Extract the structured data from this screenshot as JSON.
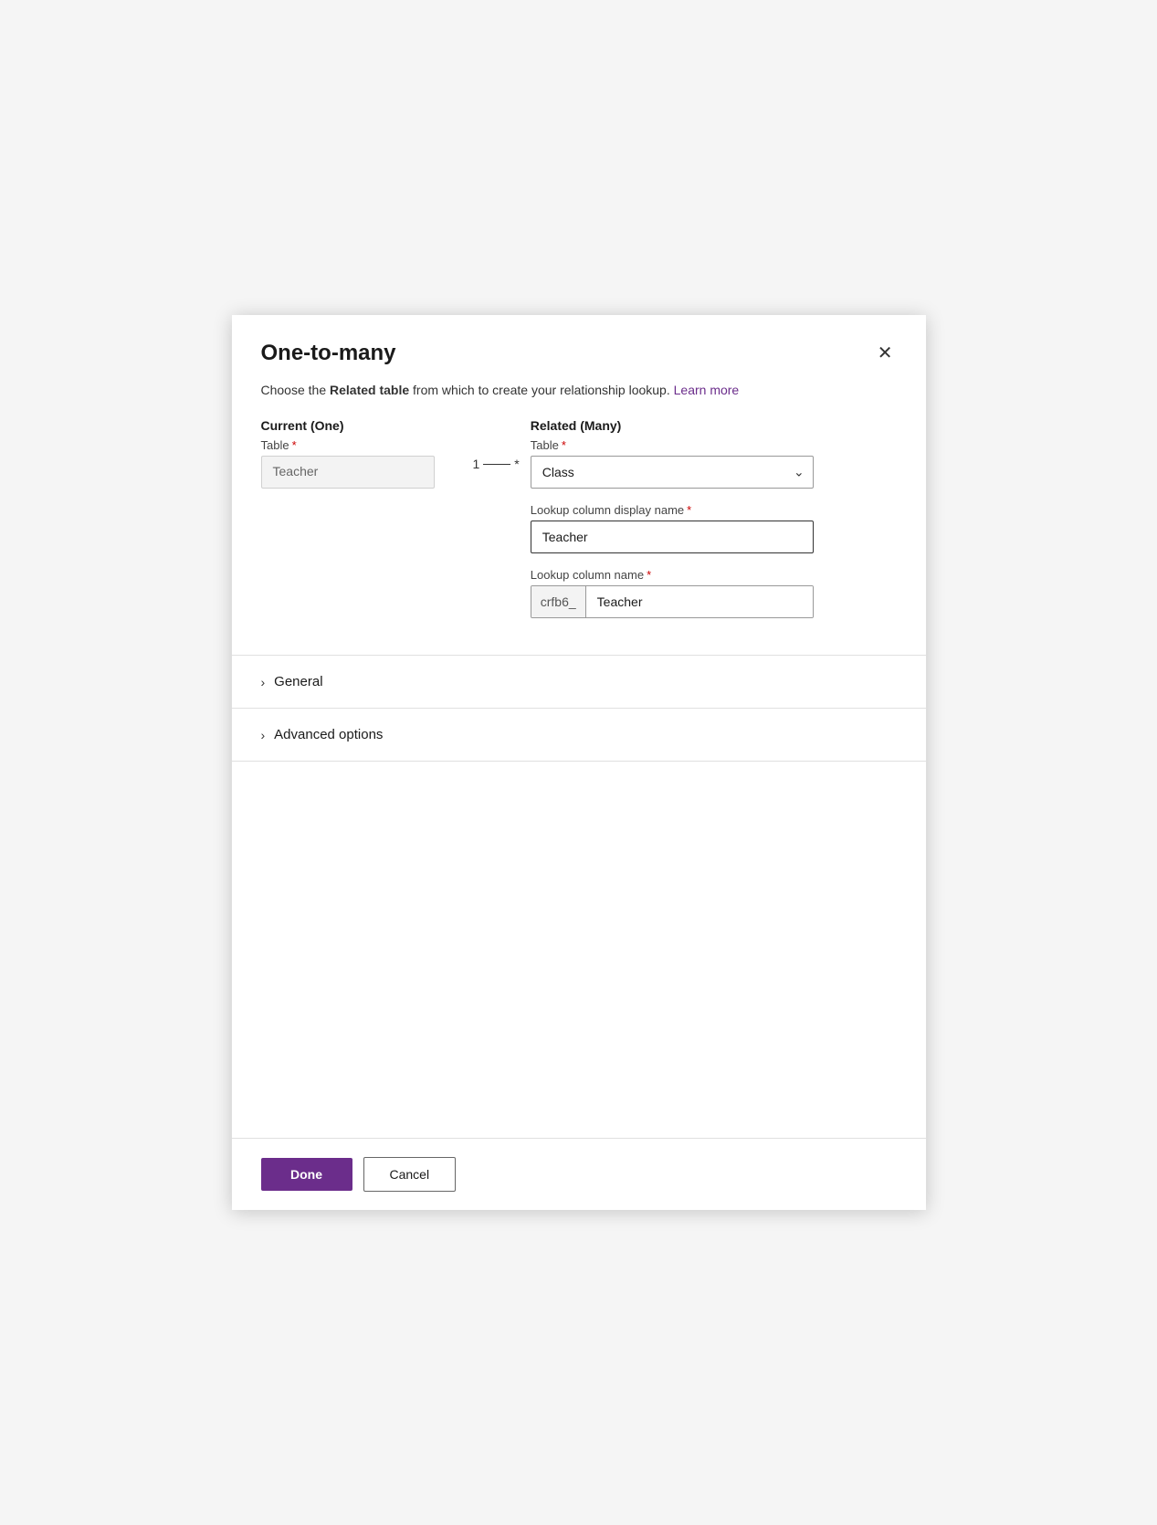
{
  "dialog": {
    "title": "One-to-many",
    "close_label": "×",
    "description_text": "Choose the ",
    "description_bold": "Related table",
    "description_after": " from which to create your relationship lookup.",
    "learn_more_label": "Learn more"
  },
  "current_section": {
    "heading": "Current (One)",
    "table_label": "Table",
    "required_indicator": "*",
    "table_value": "Teacher",
    "connector_left": "1",
    "connector_dash": "—",
    "connector_right": "*"
  },
  "related_section": {
    "heading": "Related (Many)",
    "table_label": "Table",
    "required_indicator": "*",
    "table_value": "Class",
    "lookup_display_label": "Lookup column display name",
    "lookup_display_value": "Teacher",
    "lookup_name_label": "Lookup column name",
    "lookup_name_prefix": "crfb6_",
    "lookup_name_value": "Teacher"
  },
  "general_section": {
    "title": "General"
  },
  "advanced_section": {
    "title": "Advanced options"
  },
  "footer": {
    "done_label": "Done",
    "cancel_label": "Cancel"
  },
  "icons": {
    "close": "✕",
    "chevron_right": "›",
    "chevron_down": "⌄"
  }
}
